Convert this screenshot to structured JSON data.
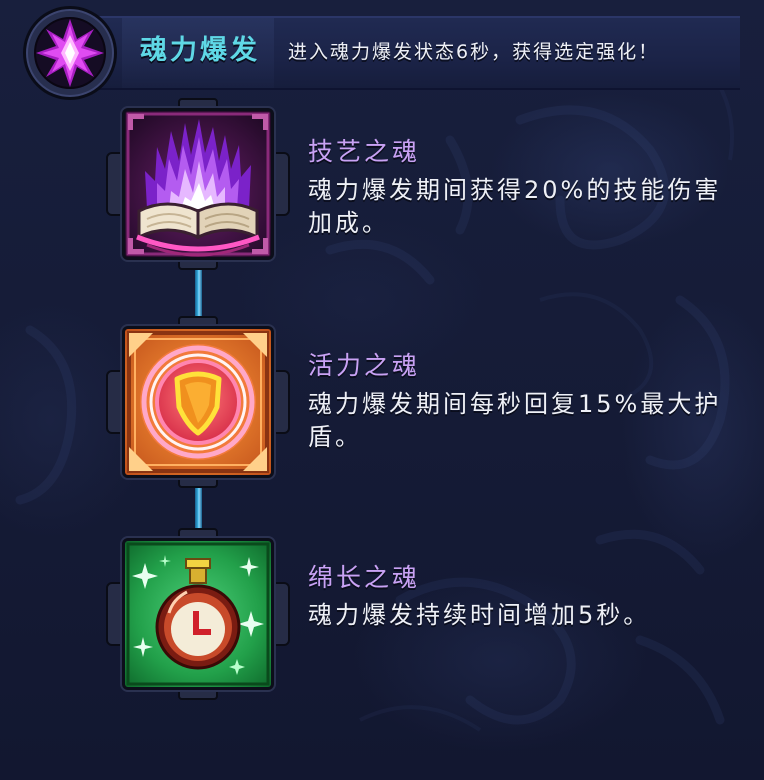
{
  "header": {
    "emblem_icon": "soul-crystal-icon",
    "title": "魂力爆发",
    "description": "进入魂力爆发状态6秒，获得选定强化！"
  },
  "skills": [
    {
      "icon": "purple-flame-book-icon",
      "name": "技艺之魂",
      "description_lines": [
        "魂力爆发期间获得20%的技能伤害",
        "加成。"
      ]
    },
    {
      "icon": "orange-shield-ring-icon",
      "name": "活力之魂",
      "description_lines": [
        "魂力爆发期间每秒回复15%最大护",
        "盾。"
      ]
    },
    {
      "icon": "green-clock-flask-icon",
      "name": "绵长之魂",
      "description_lines": [
        "魂力爆发持续时间增加5秒。"
      ]
    }
  ],
  "colors": {
    "title": "#5fd8e6",
    "skill_name": "#c9a2f4",
    "description_text": "#eef0f6",
    "connector": "#3ab4e6",
    "background": "#151b36",
    "header_bar": "#1b2347"
  }
}
